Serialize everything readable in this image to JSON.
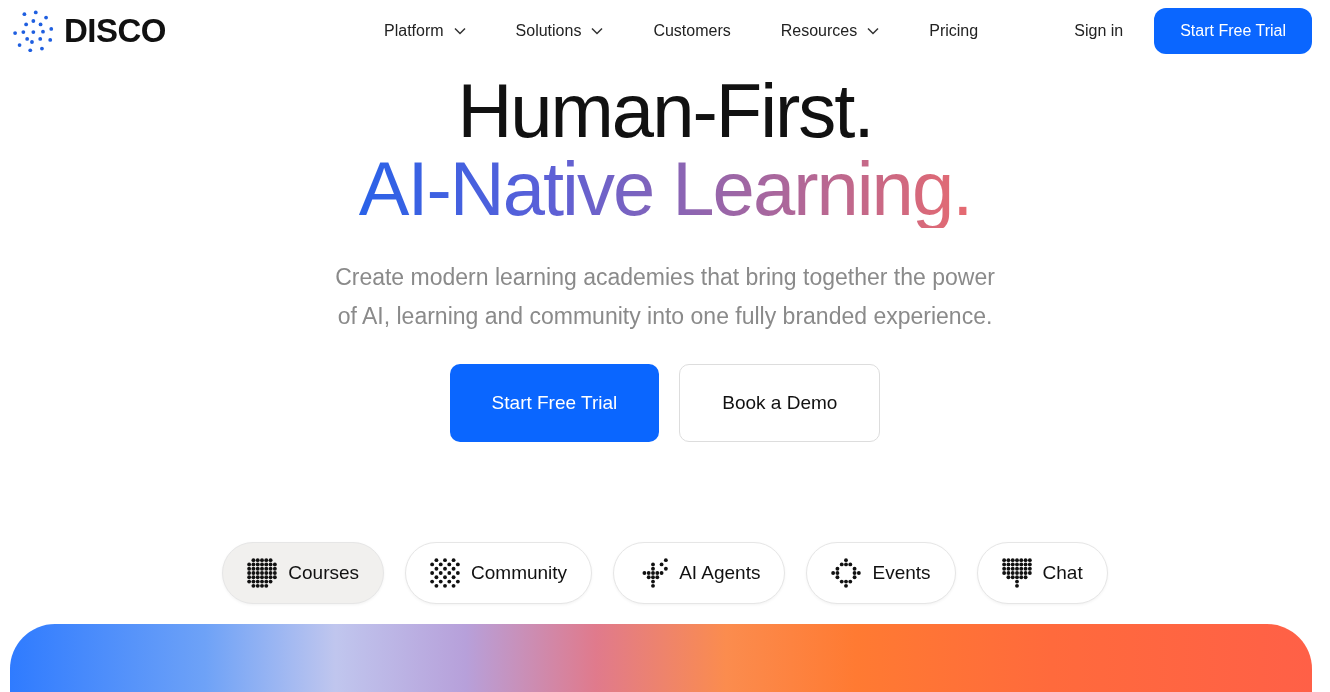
{
  "brand": {
    "name": "DISCO"
  },
  "nav": [
    {
      "label": "Platform",
      "dropdown": true
    },
    {
      "label": "Solutions",
      "dropdown": true
    },
    {
      "label": "Customers",
      "dropdown": false
    },
    {
      "label": "Resources",
      "dropdown": true
    },
    {
      "label": "Pricing",
      "dropdown": false
    }
  ],
  "header_actions": {
    "sign_in": "Sign in",
    "trial": "Start Free Trial"
  },
  "hero": {
    "title_line_1": "Human-First.",
    "title_line_2": "AI-Native Learning.",
    "subtitle": "Create modern learning academies that bring together the power of AI, learning and community into one fully branded experience.",
    "primary": "Start Free Trial",
    "secondary": "Book a Demo"
  },
  "tabs": [
    {
      "label": "Courses",
      "selected": true
    },
    {
      "label": "Community",
      "selected": false
    },
    {
      "label": "AI Agents",
      "selected": false
    },
    {
      "label": "Events",
      "selected": false
    },
    {
      "label": "Chat",
      "selected": false
    }
  ]
}
